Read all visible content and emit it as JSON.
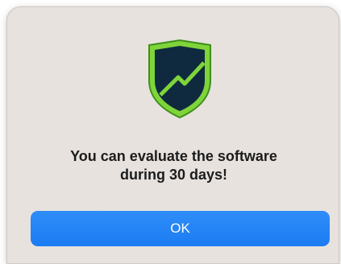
{
  "dialog": {
    "icon": "shield-trend-icon",
    "message_line1": "You can evaluate the software",
    "message_line2": "during 30 days!",
    "ok_label": "OK"
  },
  "colors": {
    "dialog_bg": "#e7e2de",
    "button_bg": "#1f7ff5",
    "shield_outer": "#7fd43a",
    "shield_inner": "#0f2a3f",
    "text": "#1c1c1c"
  }
}
